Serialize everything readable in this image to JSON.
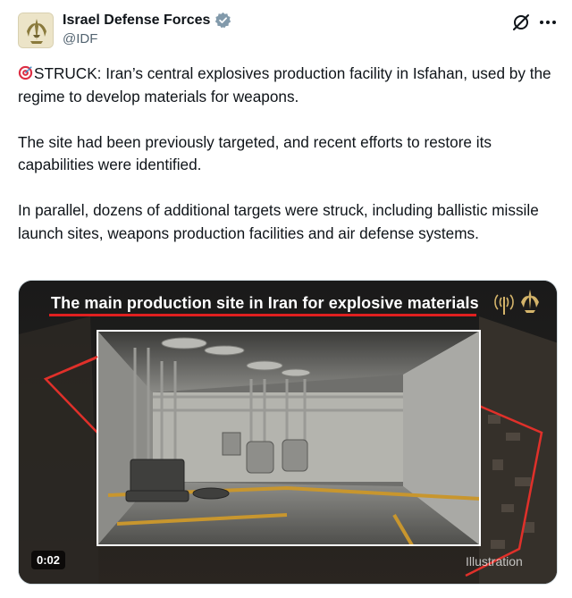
{
  "header": {
    "display_name": "Israel Defense Forces",
    "handle": "@IDF"
  },
  "tweet": {
    "paragraphs": [
      "STRUCK: Iran’s central explosives production facility in Isfahan, used by the regime to develop materials for weapons.",
      "The site had been previously targeted, and recent efforts to restore its capabilities were identified.",
      "In parallel, dozens of additional targets were struck, including ballistic missile launch sites, weapons production facilities and air defense systems."
    ]
  },
  "media": {
    "title": "The main production site in Iran for explosive materials",
    "timestamp": "0:02",
    "caption": "Illustration"
  },
  "icons": {
    "verified": "verified-badge-icon",
    "grok": "grok-icon",
    "more": "more-options-icon",
    "target": "direct-hit-target-icon"
  },
  "colors": {
    "verified_badge": "#829aab",
    "text": "#0f1419",
    "secondary": "#536471",
    "title_underline": "#e02020",
    "highlight_frame": "#e0302a"
  }
}
